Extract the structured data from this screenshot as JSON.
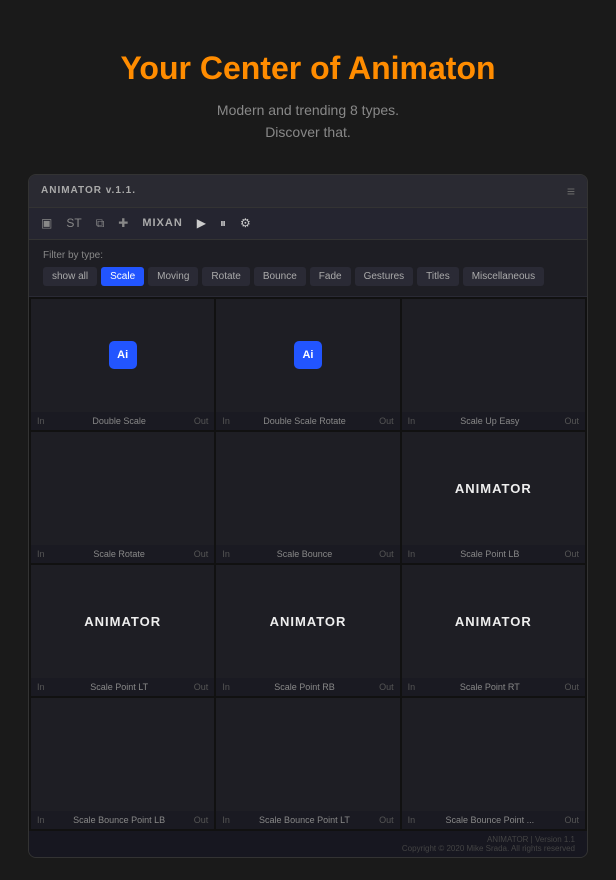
{
  "hero": {
    "title": "Your Center of Animaton",
    "subtitle_line1": "Modern and trending 8 types.",
    "subtitle_line2": "Discover that."
  },
  "titlebar": {
    "label": "ANIMATOR v.1.1.",
    "menu_icon": "≡"
  },
  "toolbar": {
    "icons": [
      "▣",
      "ST",
      "⧉",
      "✚"
    ],
    "mixan_label": "MIXAN",
    "play_icon": "▶",
    "pause_icon": "⏸",
    "settings_icon": "⚙"
  },
  "filter": {
    "label": "Filter by type:",
    "buttons": [
      {
        "id": "all",
        "label": "show all",
        "active": false
      },
      {
        "id": "scale",
        "label": "Scale",
        "active": true
      },
      {
        "id": "moving",
        "label": "Moving",
        "active": false
      },
      {
        "id": "rotate",
        "label": "Rotate",
        "active": false
      },
      {
        "id": "bounce",
        "label": "Bounce",
        "active": false
      },
      {
        "id": "fade",
        "label": "Fade",
        "active": false
      },
      {
        "id": "gestures",
        "label": "Gestures",
        "active": false
      },
      {
        "id": "titles",
        "label": "Titles",
        "active": false
      },
      {
        "id": "misc",
        "label": "Miscellaneous",
        "active": false
      }
    ]
  },
  "grid": [
    {
      "name": "Double Scale",
      "type": "icon",
      "icon_text": "Ai"
    },
    {
      "name": "Double Scale Rotate",
      "type": "icon",
      "icon_text": "Ai"
    },
    {
      "name": "Scale Up Easy",
      "type": "empty"
    },
    {
      "name": "Scale Rotate",
      "type": "empty"
    },
    {
      "name": "Scale Bounce",
      "type": "empty"
    },
    {
      "name": "Scale Point LB",
      "type": "text",
      "preview_text": "ANIMATOR"
    },
    {
      "name": "Scale Point LT",
      "type": "text",
      "preview_text": "ANIMATOR"
    },
    {
      "name": "Scale Point RB",
      "type": "text",
      "preview_text": "ANIMATOR"
    },
    {
      "name": "Scale Point RT",
      "type": "text",
      "preview_text": "ANIMATOR"
    },
    {
      "name": "Scale Bounce Point LB",
      "type": "empty"
    },
    {
      "name": "Scale Bounce Point LT",
      "type": "empty"
    },
    {
      "name": "Scale Bounce Point ...",
      "type": "empty"
    }
  ],
  "footer": {
    "line1": "ANIMATOR | Version 1.1",
    "line2": "Copyright © 2020 Mike Srada. All rights reserved"
  },
  "colors": {
    "orange": "#ff8c00",
    "blue_active": "#2255ff",
    "bg_dark": "#1a1a1a",
    "bg_app": "#1e1e24"
  }
}
